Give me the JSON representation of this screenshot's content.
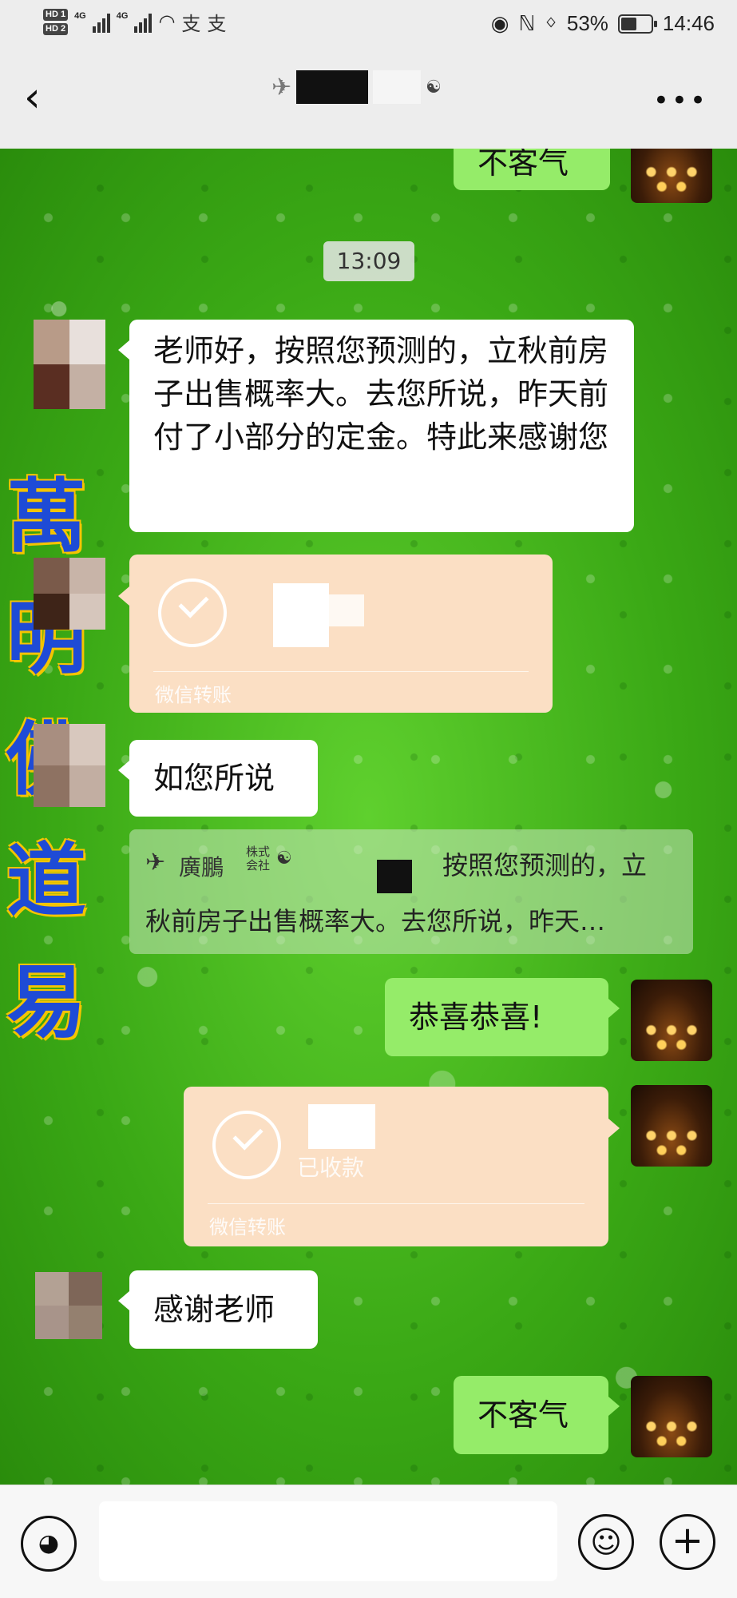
{
  "status_bar": {
    "hd1": "HD 1",
    "hd2": "HD 2",
    "net1": "4G",
    "net2": "4G",
    "battery_percent": "53%",
    "battery_level": 0.53,
    "time": "14:46"
  },
  "header": {
    "title_badge": "☯"
  },
  "watermark": {
    "chars": [
      "萬",
      "明",
      "佛",
      "道",
      "易"
    ]
  },
  "messages": {
    "m0": "不客气",
    "time1": "13:09",
    "m1": "老师好，按照您预测的，立秋前房子出售概率大。去您所说，昨天前付了小部分的定金。特此来感谢您",
    "transfer1_footer": "微信转账",
    "m2": "如您所说",
    "quote_name": "廣鵬",
    "quote_badge": "株式会社",
    "quote_line1": "按照您预测的，立",
    "quote_line2": "秋前房子出售概率大。去您所说，昨天…",
    "m3": "恭喜恭喜!",
    "transfer2_status": "已收款",
    "transfer2_footer": "微信转账",
    "m4": "感谢老师",
    "m5": "不客气"
  },
  "colors": {
    "chat_bubble_green": "#95ec69",
    "transfer_bg": "#fbdfc4",
    "watermark_blue": "#1e4bd6",
    "watermark_outline": "#f5c400"
  },
  "icons": {
    "back": "back-icon",
    "more": "more-icon",
    "voice": "voice-icon",
    "emoji": "emoji-icon",
    "plus": "plus-icon"
  }
}
